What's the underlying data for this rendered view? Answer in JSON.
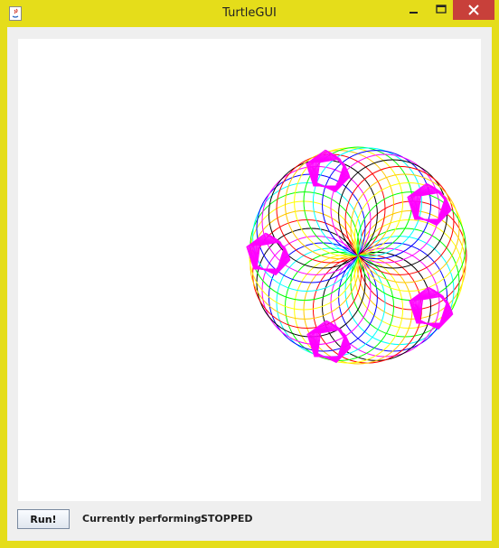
{
  "window": {
    "title": "TurtleGUI",
    "frame_color": "#e5dd1a",
    "close_color": "#c8403a"
  },
  "toolbar": {
    "run_label": "Run!",
    "status_label": "Currently performing:",
    "status_value": "STOPPED"
  },
  "drawing": {
    "ring_colors": [
      "#ff0000",
      "#ffc800",
      "#ffff00",
      "#00ff00",
      "#00ffff",
      "#0000ff",
      "#ff00ff",
      "#000000"
    ],
    "pentagon_color": "#ff00ff"
  }
}
